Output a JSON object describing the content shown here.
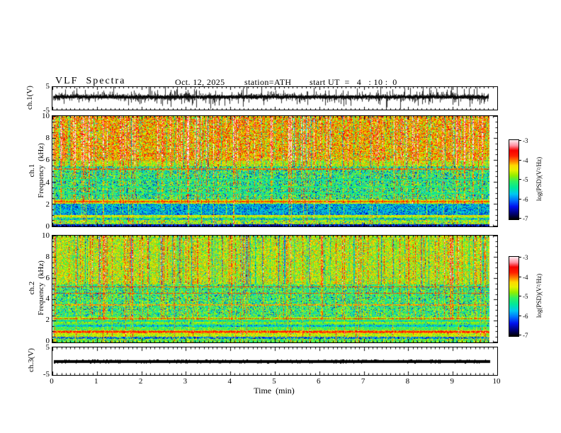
{
  "title": {
    "main": "VLF  Spectra",
    "date": "Oct. 12, 2025",
    "station": "station=ATH",
    "start_ut": "start UT  =   4   : 10 :  0"
  },
  "panels": {
    "wave1_label": "ch.1(V)",
    "spec1_ch": "ch.1",
    "spec1_freq": "Frequency  (kHz)",
    "spec2_ch": "ch.2",
    "spec2_freq": "Frequency  (kHz)",
    "wave3_label": "ch.3(V)"
  },
  "x_axis": {
    "label": "Time  (min)",
    "ticks": [
      "0",
      "1",
      "2",
      "3",
      "4",
      "5",
      "6",
      "7",
      "8",
      "9",
      "10"
    ]
  },
  "freq_axis": {
    "ticks": [
      "10",
      "8",
      "6",
      "4",
      "2",
      "0"
    ]
  },
  "volt_axis": {
    "ticks": [
      "5",
      "-5"
    ]
  },
  "colorbar": {
    "label": "log(PSD)(V²/Hz)",
    "ticks": [
      "-3",
      "-4",
      "-5",
      "-6",
      "-7"
    ]
  },
  "chart_data": {
    "type": "heatmap",
    "figure": "VLF receiver summary plot: ch.1 voltage waveform, ch.1 and ch.2 spectrograms, ch.3 voltage waveform",
    "xlabel": "Time  (min)",
    "x_range_min": [
      0,
      10
    ],
    "data_end_min": 9.8,
    "panels": [
      {
        "channel": "ch.1",
        "kind": "waveform",
        "ylabel": "ch.1(V)",
        "ylim": [
          -5,
          5
        ],
        "description": "dense impulsive broadband noise centered near +0.5 V with spikes reaching ±5 V"
      },
      {
        "channel": "ch.1",
        "kind": "spectrogram",
        "ylabel": "Frequency  (kHz)",
        "ylim_khz": [
          0,
          10
        ],
        "color_scale": "log(PSD)(V²/Hz)",
        "clim": [
          -7,
          -3
        ],
        "description": "strong (red/yellow) PSD above 6 kHz, green mid-band with blue speckle 2.4-5.4 kHz, dark blue band 1-2 kHz, layered bands below 1 kHz, vertical impulsive streaks"
      },
      {
        "channel": "ch.2",
        "kind": "spectrogram",
        "ylabel": "Frequency  (kHz)",
        "ylim_khz": [
          0,
          10
        ],
        "color_scale": "log(PSD)(V²/Hz)",
        "clim": [
          -7,
          -3
        ],
        "description": "green/yellow above 5.4 kHz with red streaks, narrow red lines at 5.2/4.6/3.5/2.2 kHz, red band near 1 kHz, dark band 0.3-0.5 kHz"
      },
      {
        "channel": "ch.3",
        "kind": "waveform",
        "ylabel": "ch.3(V)",
        "ylim": [
          -5,
          5
        ],
        "description": "flat heavy black trace at 0 V"
      }
    ],
    "colormap_stops": [
      [
        0.0,
        "#000000"
      ],
      [
        0.07,
        "#000070"
      ],
      [
        0.16,
        "#0010ee"
      ],
      [
        0.24,
        "#0070ff"
      ],
      [
        0.32,
        "#00c8f0"
      ],
      [
        0.4,
        "#00e89a"
      ],
      [
        0.48,
        "#30f060"
      ],
      [
        0.55,
        "#90ee00"
      ],
      [
        0.62,
        "#e6f000"
      ],
      [
        0.68,
        "#ffd800"
      ],
      [
        0.74,
        "#ff7700"
      ],
      [
        0.8,
        "#ff2000"
      ],
      [
        0.87,
        "#f50000"
      ],
      [
        0.93,
        "#ff8fa0"
      ],
      [
        1.0,
        "#ffeef2"
      ]
    ],
    "wave1": {
      "seed": 7,
      "center_v": 0.45,
      "spike_prob": 0.36,
      "spike_max": 4.6
    },
    "spec1": {
      "seed": 42,
      "streak_prob": 0.2,
      "streak_amp": [
        0.18,
        0.42
      ],
      "streak_fmin": 2.05,
      "streak_full_prob": 0.35,
      "neg_streak_prob": 0.1,
      "bands": [
        {
          "f": [
            6.0,
            10.05
          ],
          "base": 0.7,
          "noise": 0.16,
          "sp": 0.1,
          "sv": -0.28
        },
        {
          "f": [
            5.45,
            6.0
          ],
          "base": 0.6,
          "noise": 0.15,
          "sp": 0.05,
          "sv": -0.2
        },
        {
          "f": [
            2.4,
            5.45
          ],
          "base": 0.47,
          "noise": 0.15,
          "sp": 0.22,
          "sv": -0.24
        },
        {
          "f": [
            2.05,
            2.4
          ],
          "base": 0.6,
          "noise": 0.1,
          "sp": 0.05,
          "sv": -0.15
        },
        {
          "f": [
            1.02,
            2.05
          ],
          "base": 0.36,
          "noise": 0.12,
          "sp": 0.38,
          "sv": -0.16
        },
        {
          "f": [
            0.75,
            1.02
          ],
          "base": 0.56,
          "noise": 0.1,
          "sp": 0.08,
          "sv": -0.2
        },
        {
          "f": [
            0.55,
            0.75
          ],
          "base": 0.46,
          "noise": 0.08,
          "sp": 0.35,
          "sv": -0.22
        },
        {
          "f": [
            0.18,
            0.55
          ],
          "base": 0.58,
          "noise": 0.13,
          "sp": 0.15,
          "sv": -0.3
        },
        {
          "f": [
            0.0,
            0.18
          ],
          "base": 0.15,
          "noise": 0.1,
          "sp": 0.2,
          "sv": -0.1
        }
      ],
      "hlines": [
        {
          "f": 5.2,
          "v": 0.76
        },
        {
          "f": 2.2,
          "v": 0.78
        },
        {
          "f": 0.95,
          "v": 0.66
        },
        {
          "f": 4.2,
          "v": 0.42
        },
        {
          "f": 3.6,
          "v": 0.44
        },
        {
          "f": 3.0,
          "v": 0.42
        }
      ]
    },
    "spec2": {
      "seed": 99,
      "streak_prob": 0.17,
      "streak_amp": [
        0.16,
        0.38
      ],
      "streak_fmin": 2.1,
      "streak_full_prob": 0.3,
      "neg_streak_prob": 0.12,
      "bands": [
        {
          "f": [
            5.45,
            10.05
          ],
          "base": 0.6,
          "noise": 0.15,
          "sp": 0.06,
          "sv": -0.25
        },
        {
          "f": [
            2.4,
            5.45
          ],
          "base": 0.48,
          "noise": 0.15,
          "sp": 0.18,
          "sv": -0.22
        },
        {
          "f": [
            2.1,
            2.4
          ],
          "base": 0.56,
          "noise": 0.1,
          "sp": 0.05,
          "sv": -0.12
        },
        {
          "f": [
            1.92,
            2.1
          ],
          "base": 0.44,
          "noise": 0.1,
          "sp": 0.2,
          "sv": -0.12
        },
        {
          "f": [
            1.45,
            1.92
          ],
          "base": 0.38,
          "noise": 0.11,
          "sp": 0.3,
          "sv": -0.14
        },
        {
          "f": [
            1.12,
            1.45
          ],
          "base": 0.5,
          "noise": 0.1,
          "sp": 0.1,
          "sv": -0.15
        },
        {
          "f": [
            0.8,
            1.12
          ],
          "base": 0.72,
          "noise": 0.09,
          "sp": 0.04,
          "sv": -0.15
        },
        {
          "f": [
            0.52,
            0.8
          ],
          "base": 0.6,
          "noise": 0.1,
          "sp": 0.06,
          "sv": -0.18
        },
        {
          "f": [
            0.3,
            0.52
          ],
          "base": 0.22,
          "noise": 0.14,
          "sp": 0.25,
          "sv": 0.35
        },
        {
          "f": [
            0.0,
            0.3
          ],
          "base": 0.52,
          "noise": 0.14,
          "sp": 0.15,
          "sv": -0.2
        }
      ],
      "hlines": [
        {
          "f": 5.2,
          "v": 0.8
        },
        {
          "f": 4.6,
          "v": 0.78
        },
        {
          "f": 3.5,
          "v": 0.72
        },
        {
          "f": 2.2,
          "v": 0.8
        },
        {
          "f": 1.85,
          "v": 0.56
        },
        {
          "f": 1.72,
          "v": 0.52
        },
        {
          "f": 0.97,
          "v": 0.82
        }
      ]
    }
  }
}
